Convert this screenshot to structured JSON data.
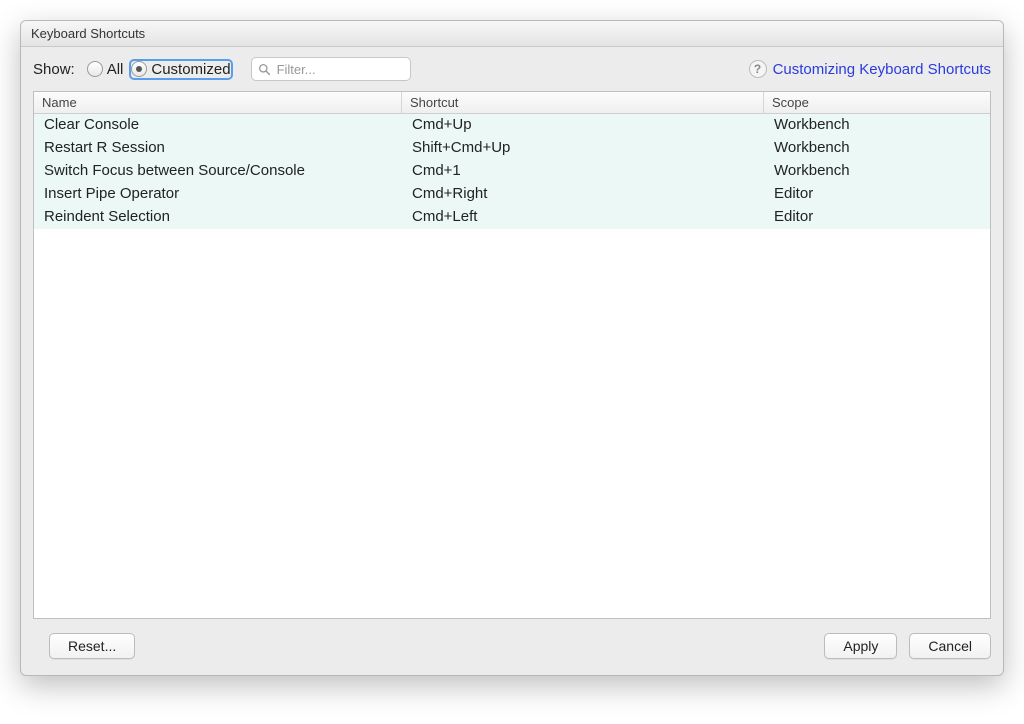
{
  "window": {
    "title": "Keyboard Shortcuts"
  },
  "toolbar": {
    "show_label": "Show:",
    "radio_all": "All",
    "radio_customized": "Customized",
    "filter_placeholder": "Filter...",
    "help_link": "Customizing Keyboard Shortcuts"
  },
  "table": {
    "headers": {
      "name": "Name",
      "shortcut": "Shortcut",
      "scope": "Scope"
    },
    "rows": [
      {
        "name": "Clear Console",
        "shortcut": "Cmd+Up",
        "scope": "Workbench"
      },
      {
        "name": "Restart R Session",
        "shortcut": "Shift+Cmd+Up",
        "scope": "Workbench"
      },
      {
        "name": "Switch Focus between Source/Console",
        "shortcut": "Cmd+1",
        "scope": "Workbench"
      },
      {
        "name": "Insert Pipe Operator",
        "shortcut": "Cmd+Right",
        "scope": "Editor"
      },
      {
        "name": "Reindent Selection",
        "shortcut": "Cmd+Left",
        "scope": "Editor"
      }
    ]
  },
  "footer": {
    "reset": "Reset...",
    "apply": "Apply",
    "cancel": "Cancel"
  }
}
